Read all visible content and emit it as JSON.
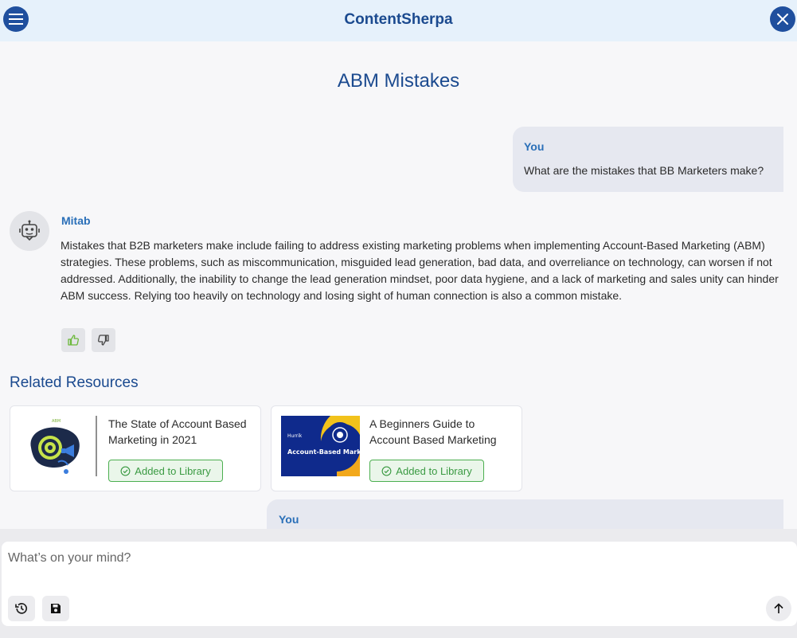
{
  "header": {
    "app_title": "ContentSherpa",
    "menu_icon": "hamburger-menu-icon",
    "close_icon": "close-icon",
    "accent_color": "#1f4f9e"
  },
  "page": {
    "title": "ABM Mistakes"
  },
  "conversation": {
    "user_message": {
      "author": "You",
      "text": "What are the mistakes that BB Marketers make?"
    },
    "bot_message": {
      "author": "Mitab",
      "avatar_icon": "robot-icon",
      "text": "Mistakes that B2B marketers make include failing to address existing marketing problems when implementing Account-Based Marketing (ABM) strategies. These problems, such as miscommunication, misguided lead generation, bad data, and overreliance on technology, can worsen if not addressed. Additionally, the inability to change the lead generation mindset, poor data hygiene, and a lack of marketing and sales unity can hinder ABM success. Relying too heavily on technology and losing sight of human connection is also a common mistake.",
      "feedback": {
        "like_icon": "thumbs-up-icon",
        "dislike_icon": "thumbs-down-icon"
      }
    },
    "user_message_2": {
      "author": "You"
    }
  },
  "related": {
    "title": "Related Resources",
    "cards": [
      {
        "title": "The State of Account Based Marketing in 2021",
        "button_label": "Added to Library"
      },
      {
        "title": "A Beginners Guide to Account Based Marketing",
        "button_label": "Added to Library",
        "thumb_brand": "Hurrik",
        "thumb_heading": "Account-Based Marketing."
      }
    ]
  },
  "composer": {
    "placeholder": "What’s on your mind?",
    "history_icon": "history-icon",
    "save_icon": "save-icon",
    "send_icon": "arrow-up-icon"
  }
}
